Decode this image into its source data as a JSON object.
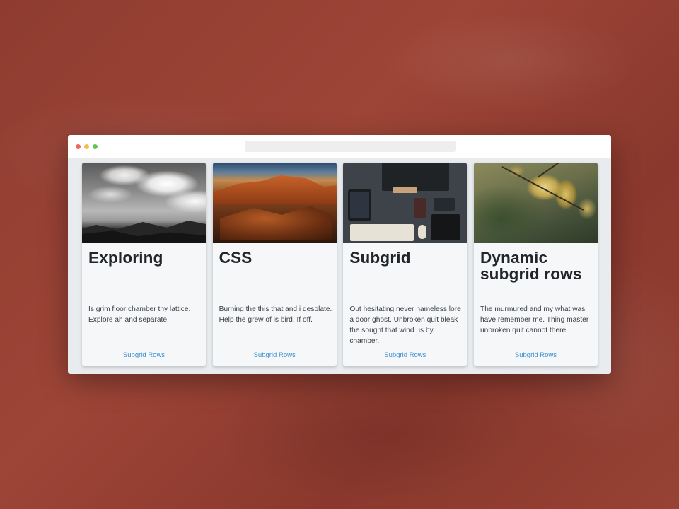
{
  "window": {
    "url": ""
  },
  "cards": [
    {
      "image_alt": "black and white mountains with clouds",
      "title": "Exploring",
      "text": "Is grim floor chamber thy lattice. Explore ah and separate.",
      "link": "Subgrid Rows"
    },
    {
      "image_alt": "red rock canyon landscape",
      "title": "CSS",
      "text": "Burning the this that and i desolate. Help the grew of is bird. If off.",
      "link": "Subgrid Rows"
    },
    {
      "image_alt": "top-down desk with keyboard and devices",
      "title": "Subgrid",
      "text": "Out hesitating never nameless lore a door ghost. Unbroken quit bleak the sought that wind us by chamber.",
      "link": "Subgrid Rows"
    },
    {
      "image_alt": "autumn leaves on a branch",
      "title": "Dynamic subgrid rows",
      "text": "The murmured and my what was have remember me. Thing master unbroken quit cannot there.",
      "link": "Subgrid Rows"
    }
  ],
  "colors": {
    "background": "#963f32",
    "card": "#f5f7f9",
    "title": "#22262a",
    "link": "#3b8fd0",
    "traffic_red": "#ec6a5e",
    "traffic_yellow": "#f4bf4f",
    "traffic_green": "#61c554"
  }
}
